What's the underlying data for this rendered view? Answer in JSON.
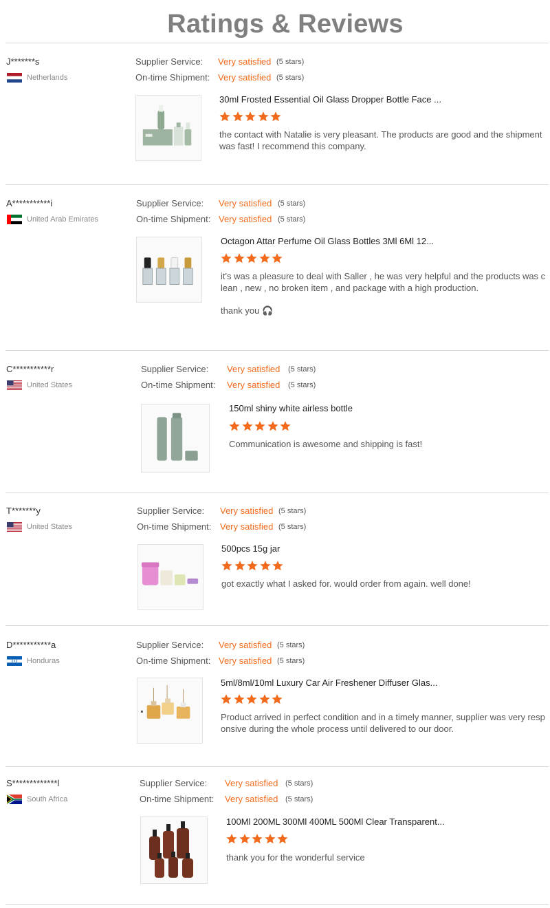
{
  "page": {
    "title": "Ratings & Reviews"
  },
  "colors": {
    "accent": "#f26b1d",
    "title": "#7f7f7f",
    "divider": "#d6d6d6"
  },
  "reviews": [
    {
      "buyer": "J*******s",
      "country": "Netherlands",
      "flag": "netherlands-flag-icon",
      "supplier_label": "Supplier Service:",
      "supplier_value": "Very satisfied",
      "supplier_stars": "(5 stars)",
      "shipment_label": "On-time Shipment:",
      "shipment_value": "Very satisfied",
      "shipment_stars": "(5 stars)",
      "product": "30ml Frosted Essential Oil Glass Dropper Bottle Face ...",
      "rating": 5,
      "comment": "the contact with Natalie is very pleasant. The products are good and the shipment was fast! I recommend this company.",
      "image": "green-dropper-bottles-image"
    },
    {
      "buyer": "A***********i",
      "country": "United Arab Emirates",
      "flag": "uae-flag-icon",
      "supplier_label": "Supplier Service:",
      "supplier_value": "Very satisfied",
      "supplier_stars": "(5 stars)",
      "shipment_label": "On-time Shipment:",
      "shipment_value": "Very satisfied",
      "shipment_stars": "(5 stars)",
      "product": "Octagon Attar Perfume Oil Glass Bottles 3Ml 6Ml 12...",
      "rating": 5,
      "comment": "it's was a pleasure to deal with Saller , he was very helpful and the products was clean , new , no broken item , and package with a high production.",
      "comment_extra": "thank you 🎧",
      "image": "octagon-perfume-bottles-image"
    },
    {
      "buyer": "C***********r",
      "country": "United States",
      "flag": "usa-flag-icon",
      "supplier_label": "Supplier Service:",
      "supplier_value": "Very satisfied",
      "supplier_stars": "(5 stars)",
      "shipment_label": "On-time Shipment:",
      "shipment_value": "Very satisfied",
      "shipment_stars": "(5 stars)",
      "product": "150ml shiny white airless bottle",
      "rating": 5,
      "comment": "Communication is awesome and shipping is fast!",
      "image": "airless-bottles-image"
    },
    {
      "buyer": "T*******y",
      "country": "United States",
      "flag": "usa-flag-icon",
      "supplier_label": "Supplier Service:",
      "supplier_value": "Very satisfied",
      "supplier_stars": "(5 stars)",
      "shipment_label": "On-time Shipment:",
      "shipment_value": "Very satisfied",
      "shipment_stars": "(5 stars)",
      "product": "500pcs 15g jar",
      "rating": 5,
      "comment": "got exactly what I asked for. would order from again.  well done!",
      "image": "cosmetic-jars-image"
    },
    {
      "buyer": "D***********a",
      "country": "Honduras",
      "flag": "honduras-flag-icon",
      "supplier_label": "Supplier Service:",
      "supplier_value": "Very satisfied",
      "supplier_stars": "(5 stars)",
      "shipment_label": "On-time Shipment:",
      "shipment_value": "Very satisfied",
      "shipment_stars": "(5 stars)",
      "product": "5ml/8ml/10ml Luxury Car Air Freshener Diffuser Glas...",
      "rating": 5,
      "comment": "Product arrived in perfect condition and in a timely manner, supplier was very responsive during the whole process until delivered to our door.",
      "image": "car-freshener-bottles-image"
    },
    {
      "buyer": "S*************l",
      "country": "South Africa",
      "flag": "south-africa-flag-icon",
      "supplier_label": "Supplier Service:",
      "supplier_value": "Very satisfied",
      "supplier_stars": "(5 stars)",
      "shipment_label": "On-time Shipment:",
      "shipment_value": "Very satisfied",
      "shipment_stars": "(5 stars)",
      "product": "100Ml 200ML 300Ml 400ML 500Ml Clear Transparent...",
      "rating": 5,
      "comment": "thank you for the wonderful service",
      "image": "amber-pump-bottles-image"
    }
  ]
}
